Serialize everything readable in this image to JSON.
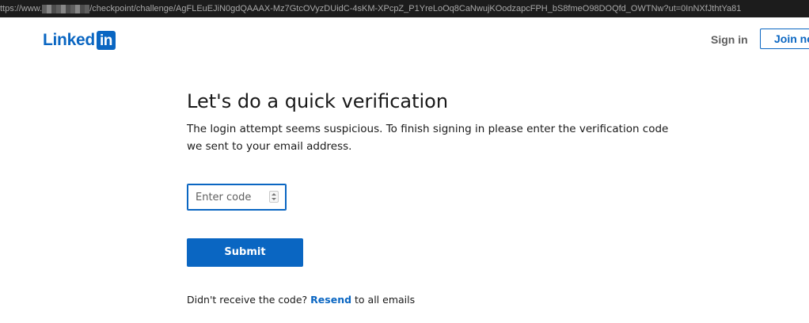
{
  "browser": {
    "url_prefix": "ttps://www.",
    "url_suffix": "/checkpoint/challenge/AgFLEuEJiN0gdQAAAX-Mz7GtcOVyzDUidC-4sKM-XPcpZ_P1YreLoOq8CaNwujKOodzapcFPH_bS8fmeO98DOQfd_OWTNw?ut=0InNXfJthtYa81"
  },
  "header": {
    "logo_text": "Linked",
    "logo_box_text": "in",
    "signin_label": "Sign in",
    "join_label": "Join no"
  },
  "main": {
    "title": "Let's do a quick verification",
    "subtitle": "The login attempt seems suspicious. To finish signing in please enter the verification code we sent to your email address.",
    "code_input": {
      "placeholder": "Enter code",
      "value": ""
    },
    "submit_label": "Submit",
    "resend": {
      "prefix": "Didn't receive the code?",
      "link": "Resend",
      "suffix": "to all emails"
    }
  },
  "colors": {
    "brand": "#0a66c2",
    "url_bar_bg": "#1c1c1c",
    "text": "#191919"
  },
  "icons": {
    "spinner": "number-stepper-icon"
  }
}
